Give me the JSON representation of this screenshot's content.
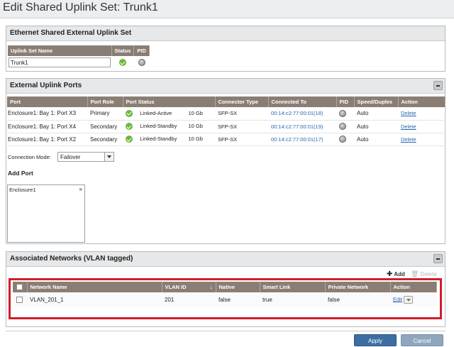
{
  "window": {
    "title": "Edit Shared Uplink Set: Trunk1"
  },
  "uplink_set": {
    "panel_title": "Ethernet Shared External Uplink Set",
    "headers": [
      "Uplink Set Name",
      "Status",
      "PID"
    ],
    "name_value": "Trunk1"
  },
  "ports": {
    "panel_title": "External Uplink Ports",
    "headers": [
      "Port",
      "Port Role",
      "Port Status",
      "Connector Type",
      "Connected To",
      "PID",
      "Speed/Duplex",
      "Action"
    ],
    "rows": [
      {
        "port": "Enclosure1: Bay 1: Port X3",
        "role": "Primary",
        "status": "Linked-Active",
        "speed": "10 Gb",
        "connector": "SFP-SX",
        "connected_to": "00:14:c2:77:00:01(18)",
        "duplex": "Auto",
        "action": "Delete"
      },
      {
        "port": "Enclosure1: Bay 1: Port X4",
        "role": "Secondary",
        "status": "Linked-Standby",
        "speed": "10 Gb",
        "connector": "SFP-SX",
        "connected_to": "00:14:c2:77:00:01(19)",
        "duplex": "Auto",
        "action": "Delete"
      },
      {
        "port": "Enclosure1: Bay 1: Port X2",
        "role": "Secondary",
        "status": "Linked-Standby",
        "speed": "10 Gb",
        "connector": "SFP-SX",
        "connected_to": "00:14:c2:77:00:01(17)",
        "duplex": "Auto",
        "action": "Delete"
      }
    ],
    "connection_mode_label": "Connection Mode:",
    "connection_mode_value": "Failover",
    "add_port_label": "Add Port",
    "add_port_tree_item": "Enclosure1",
    "add_port_tree_arrow": "»"
  },
  "networks": {
    "panel_title": "Associated Networks (VLAN tagged)",
    "add_label": "Add",
    "delete_label": "Delete",
    "headers": [
      "Network Name",
      "VLAN ID",
      "Native",
      "Smart Link",
      "Private Network",
      "Action"
    ],
    "rows": [
      {
        "name": "VLAN_201_1",
        "vlan_id": "201",
        "native": "false",
        "smart_link": "true",
        "private": "false",
        "action": "Edit"
      }
    ]
  },
  "footer": {
    "apply_label": "Apply",
    "cancel_label": "Cancel"
  },
  "colors": {
    "header_bg": "#8a7e74",
    "highlight_border": "#d01e2a",
    "apply_bg": "#3c6ea4",
    "cancel_bg": "#8fa6bd",
    "status_ok": "#6cb83a"
  }
}
